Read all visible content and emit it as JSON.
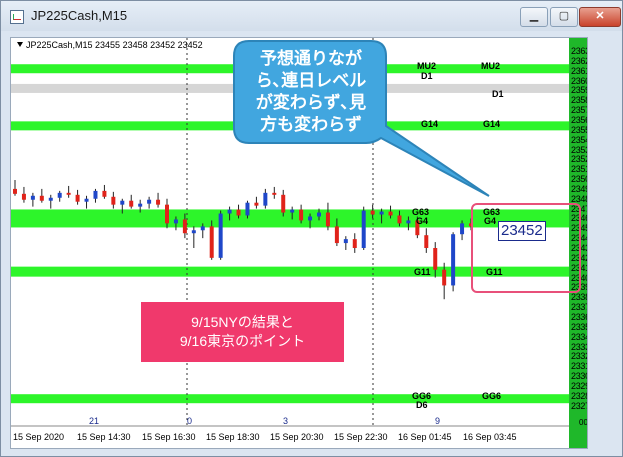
{
  "window": {
    "title": "JP225Cash,M15",
    "minimize": "▁",
    "maximize": "▢",
    "close": "✕"
  },
  "chart": {
    "info": "JP225Cash,M15  23455 23458 23452 23452",
    "price_ticks": [
      "23630",
      "23620",
      "23610",
      "23600",
      "23590",
      "23580",
      "23570",
      "23560",
      "23550",
      "23540",
      "23530",
      "23520",
      "23510",
      "23500",
      "23490",
      "23480",
      "23470",
      "23460",
      "23450",
      "23440",
      "23430",
      "23420",
      "23410",
      "23400",
      "23390",
      "23380",
      "23370",
      "23360",
      "23350",
      "23340",
      "23330",
      "23320",
      "23310",
      "23300",
      "23290",
      "23280",
      "23270"
    ],
    "time_labels": [
      "15 Sep 2020",
      "15 Sep 14:30",
      "15 Sep 16:30",
      "15 Sep 18:30",
      "15 Sep 20:30",
      "15 Sep 22:30",
      "16 Sep 01:45",
      "16 Sep 03:45"
    ],
    "hour_labels": [
      "21",
      "0",
      "3",
      "9"
    ],
    "current_price": "23452",
    "corner": "00",
    "levels": {
      "mu2_left": "MU2",
      "mu2_right": "MU2",
      "d1_left": "D1",
      "d1_right": "D1",
      "g14_left": "G14",
      "g14_right": "G14",
      "g63_left": "G63",
      "g63_right": "G63",
      "g4_left": "G4",
      "g4_right": "G4",
      "g11_left": "G11",
      "g11_right": "G11",
      "gg6_left": "GG6",
      "gg6_right": "GG6",
      "d6_left": "D6"
    }
  },
  "callout": {
    "lines": [
      "予想通りなが",
      "ら､連日レベル",
      "が変わらず､見",
      "方も変わらず"
    ]
  },
  "note": {
    "lines": [
      "9/15NYの結果と",
      "9/16東京のポイント"
    ]
  },
  "colors": {
    "band_green": "#2df52a",
    "band_gray": "#d6d6d6",
    "axis_green": "#1fb82a",
    "bull": "#1f47c9",
    "bear": "#e0231a",
    "callout": "#41a6df",
    "note": "#f0396c"
  },
  "chart_data": {
    "type": "candlestick",
    "y_unit": "price",
    "ylim": [
      23270,
      23630
    ],
    "levels": [
      {
        "name": "MU2",
        "price": 23612
      },
      {
        "name": "D1",
        "price": 23592
      },
      {
        "name": "G14",
        "price": 23554
      },
      {
        "name": "G63",
        "price": 23463
      },
      {
        "name": "G4",
        "price": 23457
      },
      {
        "name": "G11",
        "price": 23406
      },
      {
        "name": "GG6",
        "price": 23277
      }
    ],
    "candles": [
      [
        23490,
        23499,
        23483,
        23485
      ],
      [
        23485,
        23492,
        23476,
        23479
      ],
      [
        23479,
        23486,
        23472,
        23483
      ],
      [
        23483,
        23490,
        23476,
        23478
      ],
      [
        23478,
        23484,
        23470,
        23481
      ],
      [
        23481,
        23488,
        23477,
        23486
      ],
      [
        23486,
        23493,
        23481,
        23484
      ],
      [
        23484,
        23489,
        23474,
        23477
      ],
      [
        23477,
        23483,
        23470,
        23480
      ],
      [
        23480,
        23490,
        23476,
        23488
      ],
      [
        23488,
        23494,
        23480,
        23482
      ],
      [
        23482,
        23487,
        23470,
        23474
      ],
      [
        23474,
        23480,
        23465,
        23478
      ],
      [
        23478,
        23484,
        23470,
        23472
      ],
      [
        23472,
        23479,
        23466,
        23475
      ],
      [
        23475,
        23482,
        23470,
        23479
      ],
      [
        23479,
        23486,
        23471,
        23474
      ],
      [
        23474,
        23480,
        23450,
        23455
      ],
      [
        23455,
        23462,
        23448,
        23459
      ],
      [
        23459,
        23465,
        23440,
        23445
      ],
      [
        23445,
        23452,
        23430,
        23448
      ],
      [
        23448,
        23455,
        23440,
        23452
      ],
      [
        23452,
        23458,
        23418,
        23420
      ],
      [
        23420,
        23468,
        23418,
        23465
      ],
      [
        23465,
        23472,
        23458,
        23469
      ],
      [
        23469,
        23474,
        23460,
        23463
      ],
      [
        23463,
        23478,
        23460,
        23476
      ],
      [
        23476,
        23482,
        23470,
        23473
      ],
      [
        23473,
        23490,
        23470,
        23486
      ],
      [
        23486,
        23492,
        23480,
        23484
      ],
      [
        23484,
        23489,
        23462,
        23466
      ],
      [
        23466,
        23472,
        23459,
        23469
      ],
      [
        23469,
        23474,
        23455,
        23458
      ],
      [
        23458,
        23465,
        23450,
        23462
      ],
      [
        23462,
        23470,
        23458,
        23466
      ],
      [
        23466,
        23476,
        23448,
        23452
      ],
      [
        23452,
        23460,
        23432,
        23435
      ],
      [
        23435,
        23442,
        23428,
        23439
      ],
      [
        23439,
        23445,
        23425,
        23430
      ],
      [
        23430,
        23472,
        23428,
        23468
      ],
      [
        23468,
        23474,
        23460,
        23464
      ],
      [
        23464,
        23470,
        23455,
        23467
      ],
      [
        23467,
        23473,
        23460,
        23463
      ],
      [
        23463,
        23468,
        23452,
        23455
      ],
      [
        23455,
        23462,
        23448,
        23458
      ],
      [
        23458,
        23462,
        23440,
        23443
      ],
      [
        23443,
        23450,
        23425,
        23430
      ],
      [
        23430,
        23436,
        23400,
        23408
      ],
      [
        23408,
        23415,
        23378,
        23392
      ],
      [
        23392,
        23446,
        23386,
        23444
      ],
      [
        23444,
        23458,
        23438,
        23455
      ],
      [
        23455,
        23460,
        23448,
        23452
      ]
    ]
  }
}
